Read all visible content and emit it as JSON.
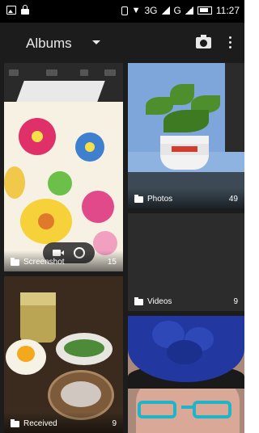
{
  "status_bar": {
    "network": "3G",
    "network2": "G",
    "time": "11:27",
    "icons": [
      "image-icon",
      "lock-icon",
      "vibrate-icon",
      "wifi-icon",
      "signal-icon",
      "battery-icon"
    ]
  },
  "action_bar": {
    "title": "Albums",
    "icons": [
      "chevron-down-icon",
      "camera-icon",
      "overflow-menu-icon"
    ]
  },
  "albums": [
    {
      "name": "Screenshot",
      "count": "15"
    },
    {
      "name": "Photos",
      "count": "49"
    },
    {
      "name": "Videos",
      "count": "9"
    },
    {
      "name": "Received",
      "count": "9"
    }
  ]
}
